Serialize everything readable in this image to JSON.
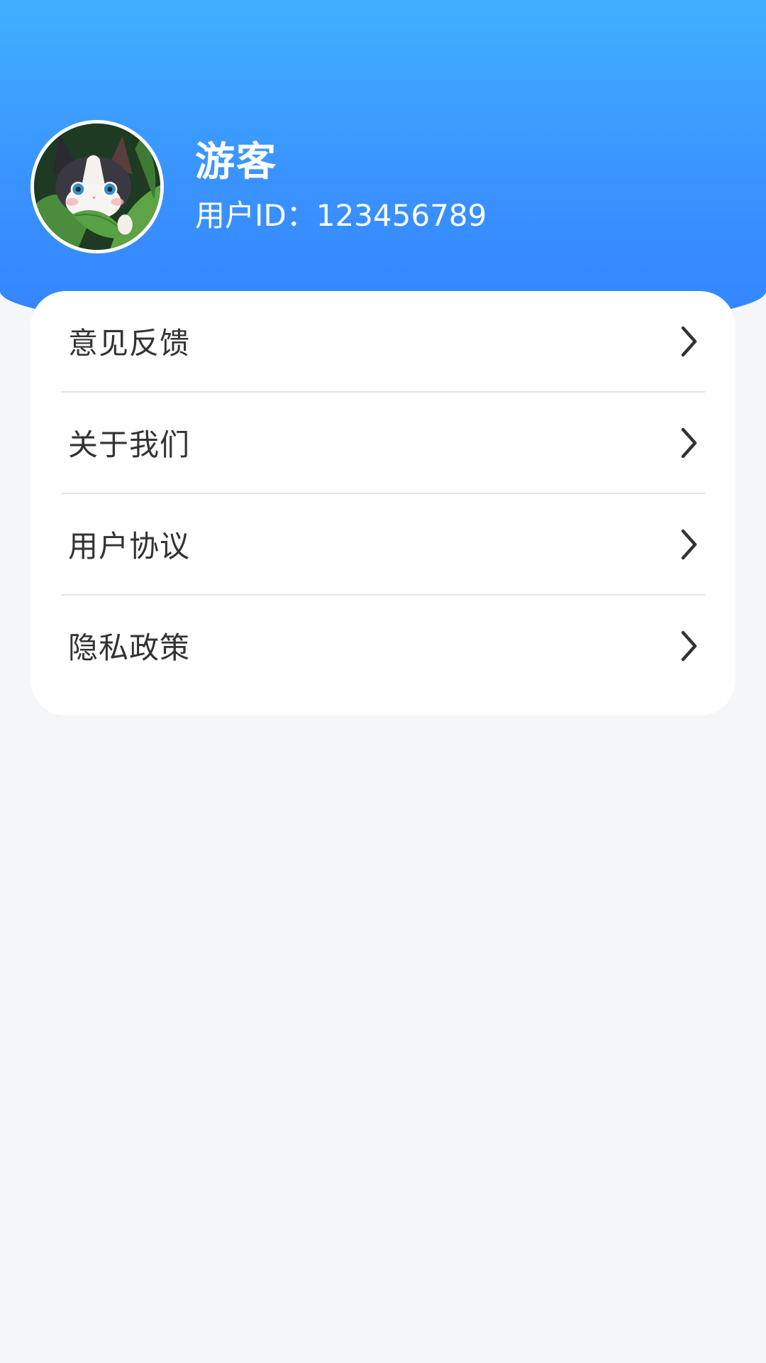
{
  "profile": {
    "username": "游客",
    "user_id_label": "用户ID：",
    "user_id_value": "123456789",
    "avatar_icon": "avatar-cat-image"
  },
  "menu": {
    "items": [
      {
        "label": "意见反馈",
        "icon": "chevron-right-icon"
      },
      {
        "label": "关于我们",
        "icon": "chevron-right-icon"
      },
      {
        "label": "用户协议",
        "icon": "chevron-right-icon"
      },
      {
        "label": "隐私政策",
        "icon": "chevron-right-icon"
      }
    ]
  },
  "colors": {
    "header_gradient_top": "#3fb0ff",
    "header_gradient_bottom": "#3484ff",
    "page_background": "#f5f6f8",
    "card_background": "#ffffff",
    "menu_text": "#333333",
    "divider": "#e4e4e6"
  }
}
